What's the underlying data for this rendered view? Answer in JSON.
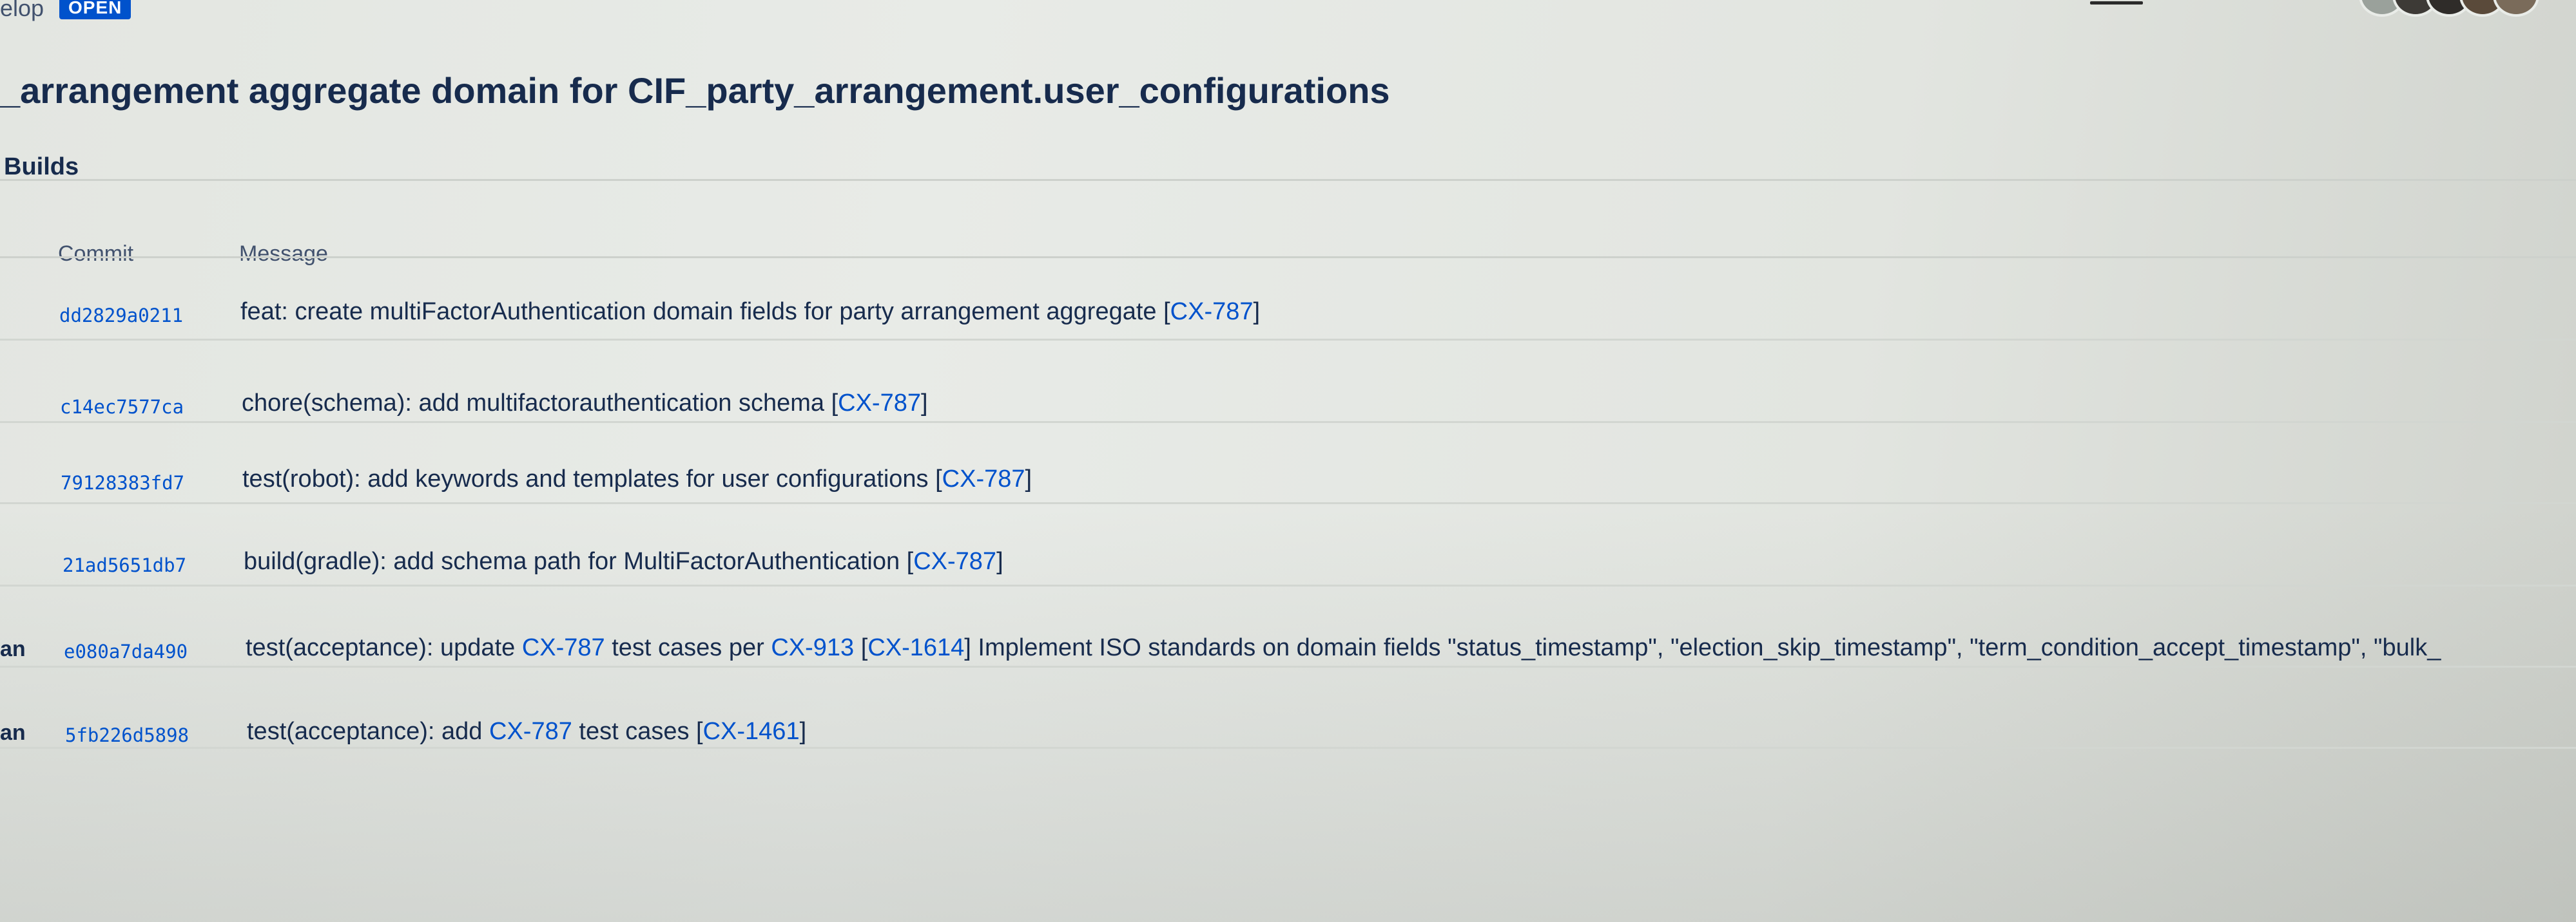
{
  "header": {
    "branch_fragment": "elop",
    "status_badge": "OPEN"
  },
  "page_title": "_arrangement aggregate domain for CIF_party_arrangement.user_configurations",
  "section": {
    "title": "Builds"
  },
  "table": {
    "columns": [
      "Commit",
      "Message"
    ],
    "rows": [
      {
        "author": "",
        "commit": "dd2829a0211",
        "message": [
          {
            "text": "feat: create multiFactorAuthentication domain fields for party arrangement aggregate ",
            "link": false
          },
          {
            "text": "[",
            "link": false
          },
          {
            "text": "CX-787",
            "link": true
          },
          {
            "text": "]",
            "link": false
          }
        ]
      },
      {
        "author": "",
        "commit": "c14ec7577ca",
        "message": [
          {
            "text": "chore(schema): add multifactorauthentication schema ",
            "link": false
          },
          {
            "text": "[",
            "link": false
          },
          {
            "text": "CX-787",
            "link": true
          },
          {
            "text": "]",
            "link": false
          }
        ]
      },
      {
        "author": "",
        "commit": "79128383fd7",
        "message": [
          {
            "text": "test(robot): add keywords and templates for user configurations ",
            "link": false
          },
          {
            "text": "[",
            "link": false
          },
          {
            "text": "CX-787",
            "link": true
          },
          {
            "text": "]",
            "link": false
          }
        ]
      },
      {
        "author": "",
        "commit": "21ad5651db7",
        "message": [
          {
            "text": "build(gradle): add schema path for MultiFactorAuthentication ",
            "link": false
          },
          {
            "text": "[",
            "link": false
          },
          {
            "text": "CX-787",
            "link": true
          },
          {
            "text": "]",
            "link": false
          }
        ]
      },
      {
        "author": "an",
        "commit": "e080a7da490",
        "message": [
          {
            "text": "test(acceptance): update ",
            "link": false
          },
          {
            "text": "CX-787",
            "link": true
          },
          {
            "text": " test cases per ",
            "link": false
          },
          {
            "text": "CX-913",
            "link": true
          },
          {
            "text": " [",
            "link": false
          },
          {
            "text": "CX-1614",
            "link": true
          },
          {
            "text": "] Implement ISO standards on domain fields \"status_timestamp\", \"election_skip_timestamp\", \"term_condition_accept_timestamp\", \"bulk_",
            "link": false
          }
        ]
      },
      {
        "author": "an",
        "commit": "5fb226d5898",
        "message": [
          {
            "text": "test(acceptance): add ",
            "link": false
          },
          {
            "text": "CX-787",
            "link": true
          },
          {
            "text": " test cases [",
            "link": false
          },
          {
            "text": "CX-1461",
            "link": true
          },
          {
            "text": "]",
            "link": false
          }
        ]
      }
    ]
  },
  "colors": {
    "link": "#0052cc",
    "text": "#172b4d",
    "badge_bg": "#0052cc"
  },
  "icons": [
    "avatar-group-icon",
    "minimize-icon"
  ]
}
